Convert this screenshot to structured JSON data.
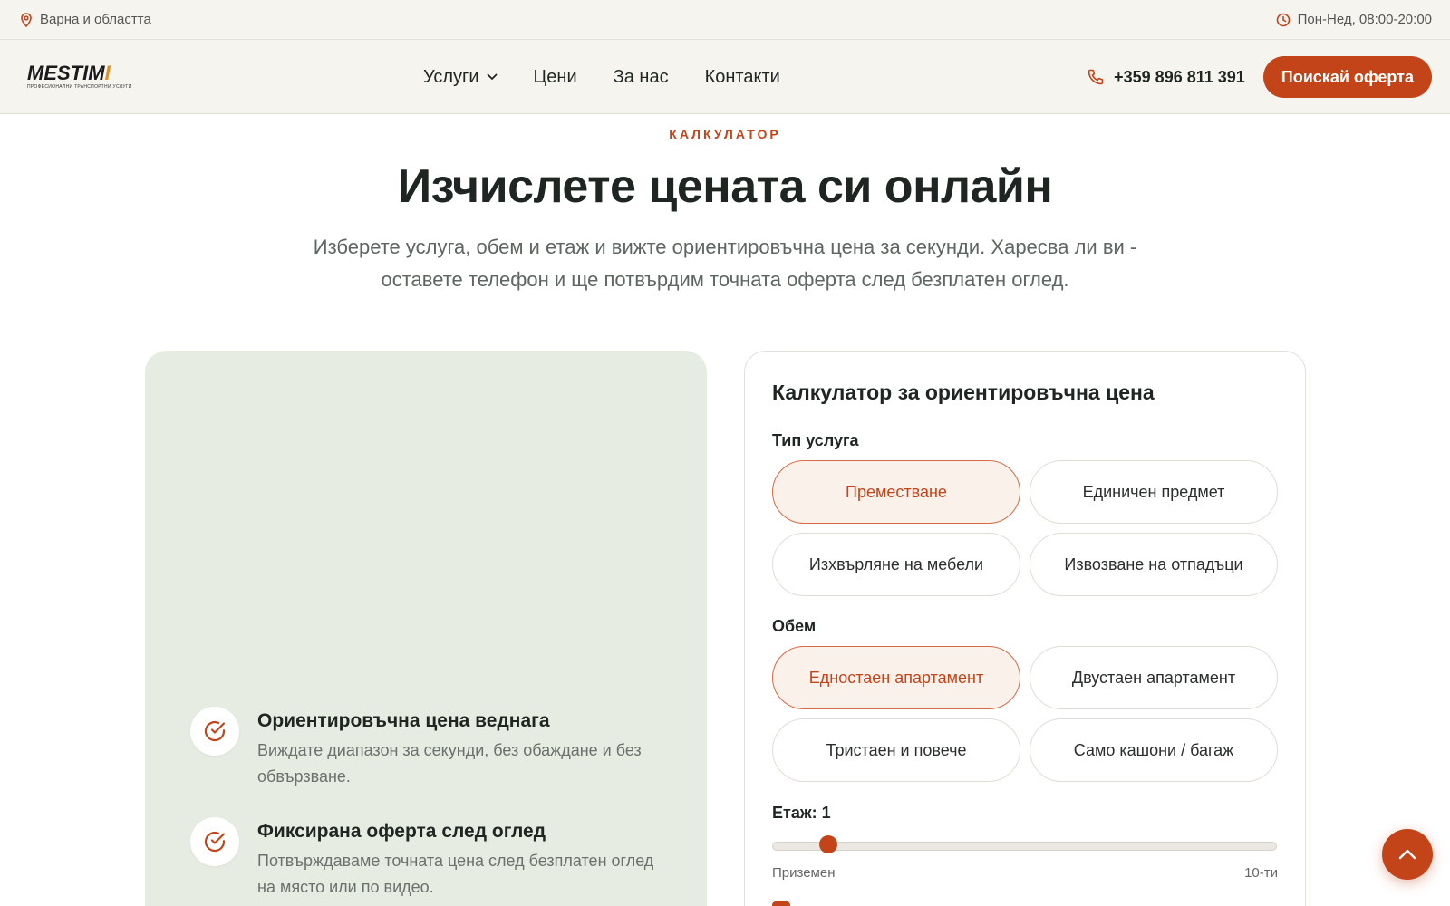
{
  "topbar": {
    "location": "Варна и областта",
    "hours": "Пон-Нед, 08:00-20:00"
  },
  "header": {
    "logo": {
      "word_main": "MESTIM",
      "word_accent": "I",
      "tagline": "ПРОФЕСИОНАЛНИ ТРАНСПОРТНИ УСЛУГИ"
    },
    "nav": [
      {
        "label": "Услуги",
        "has_dropdown": true
      },
      {
        "label": "Цени"
      },
      {
        "label": "За нас"
      },
      {
        "label": "Контакти"
      }
    ],
    "phone": "+359 896 811 391",
    "cta": "Поискай оферта"
  },
  "hero": {
    "eyebrow": "КАЛКУЛАТОР",
    "title": "Изчислете цената си онлайн",
    "subtitle": "Изберете услуга, обем и етаж и вижте ориентировъчна цена за секунди. Харесва ли ви - оставете телефон и ще потвърдим точната оферта след безплатен оглед."
  },
  "features": [
    {
      "title": "Ориентировъчна цена веднага",
      "desc": "Виждате диапазон за секунди, без обаждане и без обвързване.",
      "icon": "check-circle-icon"
    },
    {
      "title": "Фиксирана оферта след оглед",
      "desc": "Потвърждаваме точната цена след безплатен оглед на място или по видео.",
      "icon": "check-circle-icon"
    }
  ],
  "calculator": {
    "title": "Калкулатор за ориентировъчна цена",
    "service_label": "Тип услуга",
    "services": [
      {
        "label": "Преместване",
        "active": true
      },
      {
        "label": "Единичен предмет",
        "active": false
      },
      {
        "label": "Изхвърляне на мебели",
        "active": false
      },
      {
        "label": "Извозване на отпадъци",
        "active": false
      }
    ],
    "volume_label": "Обем",
    "volumes": [
      {
        "label": "Едностаен апартамент",
        "active": true
      },
      {
        "label": "Двустаен апартамент",
        "active": false
      },
      {
        "label": "Тристаен и повече",
        "active": false
      },
      {
        "label": "Само кашони / багаж",
        "active": false
      }
    ],
    "floor_label": "Етаж: 1",
    "floor_value": 1,
    "floor_min_label": "Приземен",
    "floor_max_label": "10-ти",
    "floor_min": 0,
    "floor_max": 10
  },
  "colors": {
    "accent": "#c4441a",
    "logo_accent": "#e98a1e",
    "panel_bg": "#e7ece3",
    "topbar_bg": "#f6f4ef"
  }
}
